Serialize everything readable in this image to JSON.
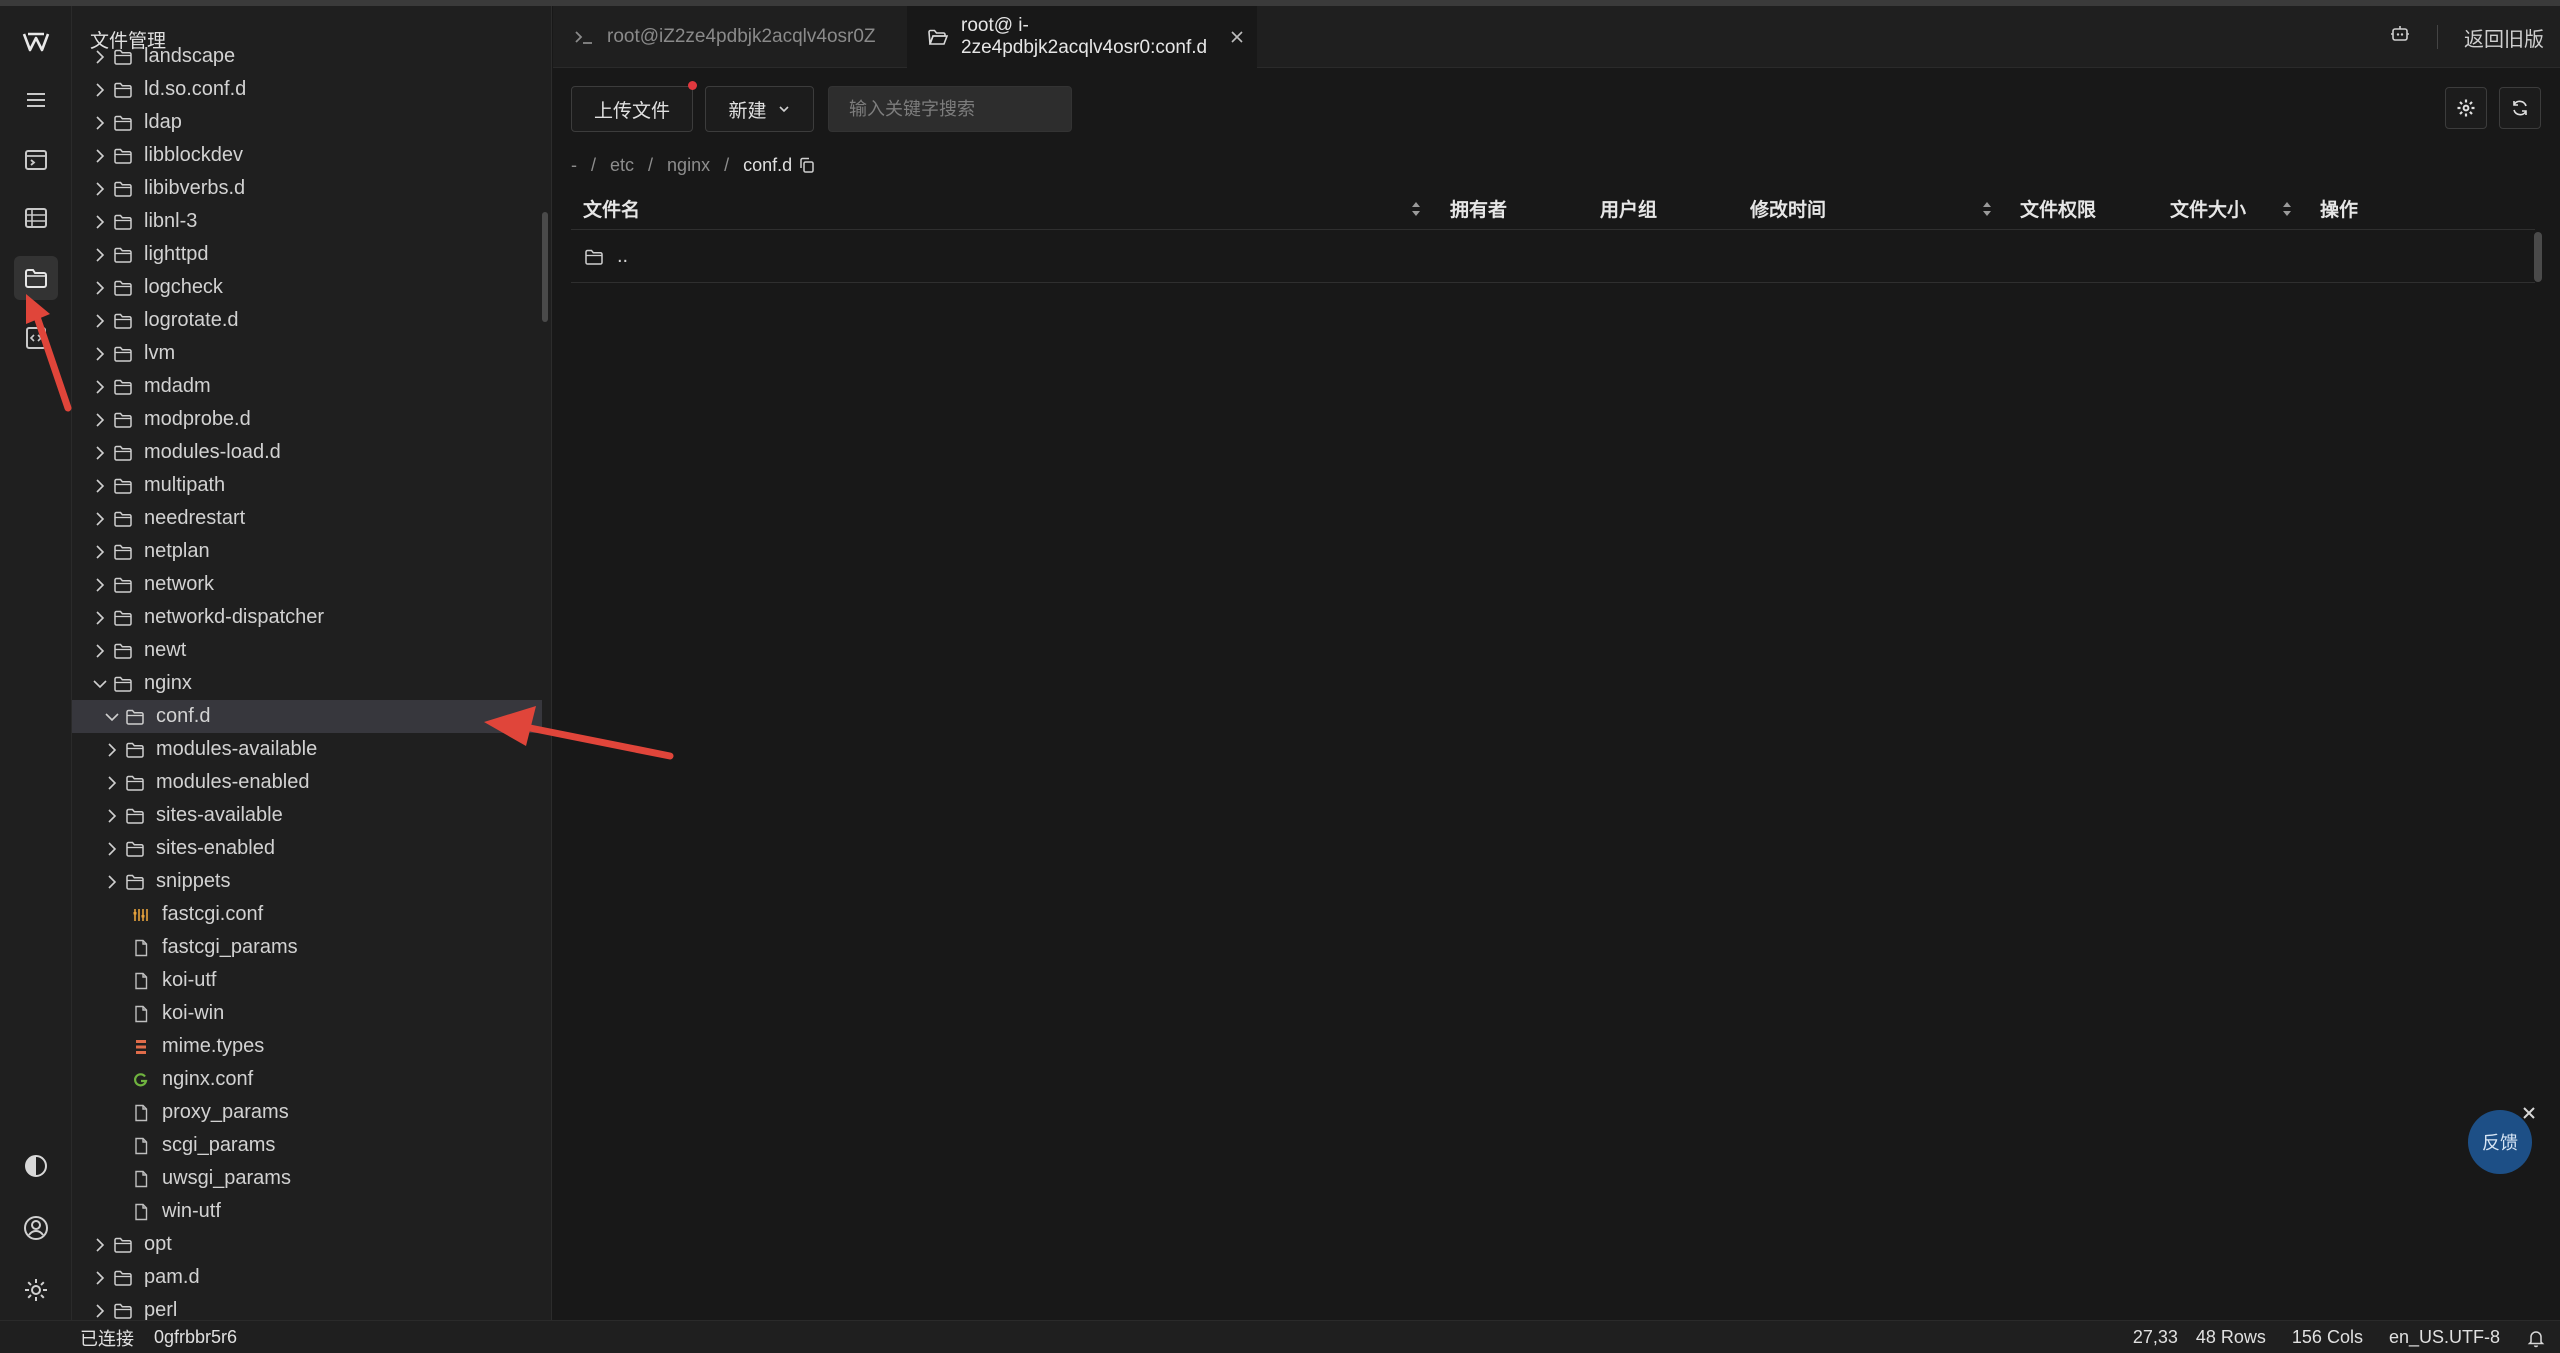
{
  "sidebar": {
    "title": "文件管理",
    "tree": [
      {
        "label": "landscape",
        "level": 0,
        "kind": "folder",
        "expanded": false
      },
      {
        "label": "ld.so.conf.d",
        "level": 0,
        "kind": "folder",
        "expanded": false
      },
      {
        "label": "ldap",
        "level": 0,
        "kind": "folder",
        "expanded": false
      },
      {
        "label": "libblockdev",
        "level": 0,
        "kind": "folder",
        "expanded": false
      },
      {
        "label": "libibverbs.d",
        "level": 0,
        "kind": "folder",
        "expanded": false
      },
      {
        "label": "libnl-3",
        "level": 0,
        "kind": "folder",
        "expanded": false
      },
      {
        "label": "lighttpd",
        "level": 0,
        "kind": "folder",
        "expanded": false
      },
      {
        "label": "logcheck",
        "level": 0,
        "kind": "folder",
        "expanded": false
      },
      {
        "label": "logrotate.d",
        "level": 0,
        "kind": "folder",
        "expanded": false
      },
      {
        "label": "lvm",
        "level": 0,
        "kind": "folder",
        "expanded": false
      },
      {
        "label": "mdadm",
        "level": 0,
        "kind": "folder",
        "expanded": false
      },
      {
        "label": "modprobe.d",
        "level": 0,
        "kind": "folder",
        "expanded": false
      },
      {
        "label": "modules-load.d",
        "level": 0,
        "kind": "folder",
        "expanded": false
      },
      {
        "label": "multipath",
        "level": 0,
        "kind": "folder",
        "expanded": false
      },
      {
        "label": "needrestart",
        "level": 0,
        "kind": "folder",
        "expanded": false
      },
      {
        "label": "netplan",
        "level": 0,
        "kind": "folder",
        "expanded": false
      },
      {
        "label": "network",
        "level": 0,
        "kind": "folder",
        "expanded": false
      },
      {
        "label": "networkd-dispatcher",
        "level": 0,
        "kind": "folder",
        "expanded": false
      },
      {
        "label": "newt",
        "level": 0,
        "kind": "folder",
        "expanded": false
      },
      {
        "label": "nginx",
        "level": 0,
        "kind": "folder",
        "expanded": true
      },
      {
        "label": "conf.d",
        "level": 1,
        "kind": "folder",
        "expanded": true,
        "selected": true
      },
      {
        "label": "modules-available",
        "level": 1,
        "kind": "folder",
        "expanded": false
      },
      {
        "label": "modules-enabled",
        "level": 1,
        "kind": "folder",
        "expanded": false
      },
      {
        "label": "sites-available",
        "level": 1,
        "kind": "folder",
        "expanded": false
      },
      {
        "label": "sites-enabled",
        "level": 1,
        "kind": "folder",
        "expanded": false
      },
      {
        "label": "snippets",
        "level": 1,
        "kind": "folder",
        "expanded": false
      },
      {
        "label": "fastcgi.conf",
        "level": 1,
        "kind": "conf"
      },
      {
        "label": "fastcgi_params",
        "level": 1,
        "kind": "file"
      },
      {
        "label": "koi-utf",
        "level": 1,
        "kind": "file"
      },
      {
        "label": "koi-win",
        "level": 1,
        "kind": "file"
      },
      {
        "label": "mime.types",
        "level": 1,
        "kind": "types"
      },
      {
        "label": "nginx.conf",
        "level": 1,
        "kind": "nginx"
      },
      {
        "label": "proxy_params",
        "level": 1,
        "kind": "file"
      },
      {
        "label": "scgi_params",
        "level": 1,
        "kind": "file"
      },
      {
        "label": "uwsgi_params",
        "level": 1,
        "kind": "file"
      },
      {
        "label": "win-utf",
        "level": 1,
        "kind": "file"
      },
      {
        "label": "opt",
        "level": 0,
        "kind": "folder",
        "expanded": false
      },
      {
        "label": "pam.d",
        "level": 0,
        "kind": "folder",
        "expanded": false
      },
      {
        "label": "perl",
        "level": 0,
        "kind": "folder",
        "expanded": false
      }
    ]
  },
  "tabs": [
    {
      "label": "root@iZ2ze4pdbjk2acqlv4osr0Z",
      "icon": "terminal-icon",
      "active": false
    },
    {
      "label": "root@ i-2ze4pdbjk2acqlv4osr0:conf.d",
      "icon": "folder-open-icon",
      "active": true
    }
  ],
  "topright": {
    "back_label": "返回旧版"
  },
  "toolbar": {
    "upload_label": "上传文件",
    "new_label": "新建",
    "search_placeholder": "输入关键字搜索"
  },
  "breadcrumb": {
    "root": "-",
    "sep": "/",
    "parts": [
      "etc",
      "nginx"
    ],
    "current": "conf.d"
  },
  "table": {
    "columns": [
      "文件名",
      "拥有者",
      "用户组",
      "修改时间",
      "文件权限",
      "文件大小",
      "操作"
    ],
    "rows": [
      {
        "name": ".."
      }
    ]
  },
  "feedback": {
    "label": "反馈"
  },
  "status": {
    "connected": "已连接",
    "host": "0gfrbbr5r6",
    "cursor": "27,33",
    "rows": "48 Rows",
    "cols": "156 Cols",
    "encoding": "en_US.UTF-8"
  },
  "colors": {
    "accent_dot": "#e0383e",
    "annotation_arrow": "#e0453a",
    "feedback_bg": "#1d4f86"
  }
}
